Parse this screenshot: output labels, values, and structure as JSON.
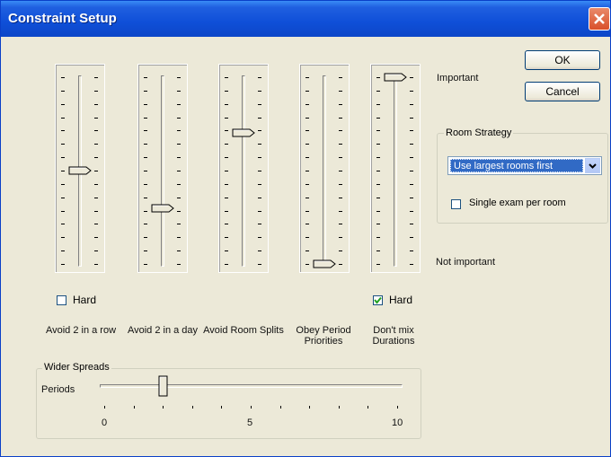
{
  "window": {
    "title": "Constraint Setup"
  },
  "sliders": [
    {
      "id": "avoid2row",
      "label": "Avoid 2 in a row",
      "level": 0.5,
      "hard": false
    },
    {
      "id": "avoid2day",
      "label": "Avoid 2 in a day",
      "level": 0.3,
      "hard": null
    },
    {
      "id": "avoidroomsplits",
      "label": "Avoid Room Splits",
      "level": 0.7,
      "hard": null
    },
    {
      "id": "obeyperiod",
      "label": "Obey Period Priorities",
      "level": 0.0,
      "hard": null
    },
    {
      "id": "dontmix",
      "label": "Don't mix Durations",
      "level": 1.0,
      "hard": true
    }
  ],
  "checkboxes": {
    "hard_left": {
      "label": "Hard",
      "checked": false
    },
    "hard_right": {
      "label": "Hard",
      "checked": true
    }
  },
  "scale": {
    "important": "Important",
    "not_important": "Not important"
  },
  "buttons": {
    "ok": "OK",
    "cancel": "Cancel"
  },
  "room_strategy": {
    "legend": "Room Strategy",
    "selected": "Use largest rooms first",
    "single_exam_label": "Single exam per room",
    "single_exam_checked": false
  },
  "wider_spreads": {
    "legend": "Wider Spreads",
    "periods_label": "Periods",
    "value": 2,
    "min": 0,
    "max": 10,
    "tick_labels": [
      "0",
      "5",
      "10"
    ]
  },
  "colors": {
    "title_bar": "#0c46c8",
    "dialog_bg": "#ece9d8",
    "close_button": "#d9502a",
    "selection": "#316ac5"
  }
}
